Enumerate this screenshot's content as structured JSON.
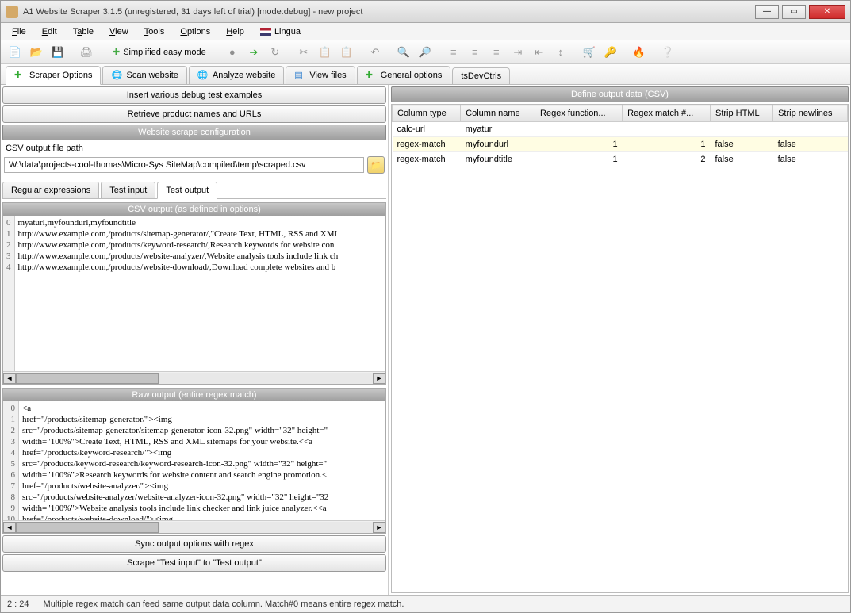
{
  "title": "A1 Website Scraper 3.1.5 (unregistered, 31 days left of trial) [mode:debug] - new project",
  "menu": [
    "File",
    "Edit",
    "Table",
    "View",
    "Tools",
    "Options",
    "Help",
    "Lingua"
  ],
  "simplified_label": "Simplified easy mode",
  "maintabs": [
    {
      "label": "Scraper Options",
      "icon": "plus-green"
    },
    {
      "label": "Scan website",
      "icon": "globe-blue"
    },
    {
      "label": "Analyze website",
      "icon": "globe-pie"
    },
    {
      "label": "View files",
      "icon": "doc-lines"
    },
    {
      "label": "General options",
      "icon": "plus-green"
    },
    {
      "label": "tsDevCtrls",
      "icon": ""
    }
  ],
  "left": {
    "debug_btn": "Insert various debug test examples",
    "retrieve_btn": "Retrieve product names and URLs",
    "config_header": "Website scrape configuration",
    "csv_path_label": "CSV output file path",
    "csv_path_value": "W:\\data\\projects-cool-thomas\\Micro-Sys SiteMap\\compiled\\temp\\scraped.csv",
    "subtabs": [
      "Regular expressions",
      "Test input",
      "Test output"
    ],
    "csv_output_title": "CSV output (as defined in options)",
    "csv_output_lines": [
      "myaturl,myfoundurl,myfoundtitle",
      "http://www.example.com,/products/sitemap-generator/,\"Create Text, HTML, RSS and XML",
      "http://www.example.com,/products/keyword-research/,Research keywords for website con",
      "http://www.example.com,/products/website-analyzer/,Website analysis tools include link ch",
      "http://www.example.com,/products/website-download/,Download complete websites and b"
    ],
    "raw_output_title": "Raw output (entire regex match)",
    "raw_output_lines": [
      "<a",
      "href=\"/products/sitemap-generator/\"><img",
      "src=\"/products/sitemap-generator/sitemap-generator-icon-32.png\" width=\"32\" height=\"",
      "width=\"100%\">Create Text, HTML, RSS and XML sitemaps for your website.<<a",
      "href=\"/products/keyword-research/\"><img",
      "src=\"/products/keyword-research/keyword-research-icon-32.png\" width=\"32\" height=\"",
      "width=\"100%\">Research keywords for website content and search engine promotion.<",
      "href=\"/products/website-analyzer/\"><img",
      "src=\"/products/website-analyzer/website-analyzer-icon-32.png\" width=\"32\" height=\"32",
      "width=\"100%\">Website analysis tools include link checker and link juice analyzer.<<a",
      "href=\"/products/website-download/\"><img"
    ],
    "sync_btn": "Sync output options with regex",
    "scrape_btn": "Scrape \"Test input\" to \"Test output\""
  },
  "right": {
    "header": "Define output data (CSV)",
    "columns": [
      "Column type",
      "Column name",
      "Regex function...",
      "Regex match #...",
      "Strip HTML",
      "Strip newlines"
    ],
    "rows": [
      {
        "type": "calc-url",
        "name": "myaturl",
        "fn": "",
        "match": "",
        "strip_html": "",
        "strip_nl": "",
        "hl": false
      },
      {
        "type": "regex-match",
        "name": "myfoundurl",
        "fn": "1",
        "match": "1",
        "strip_html": "false",
        "strip_nl": "false",
        "hl": true
      },
      {
        "type": "regex-match",
        "name": "myfoundtitle",
        "fn": "1",
        "match": "2",
        "strip_html": "false",
        "strip_nl": "false",
        "hl": false
      }
    ]
  },
  "status": {
    "pos": "2 : 24",
    "msg": "Multiple regex match can feed same output data column. Match#0 means entire regex match."
  }
}
